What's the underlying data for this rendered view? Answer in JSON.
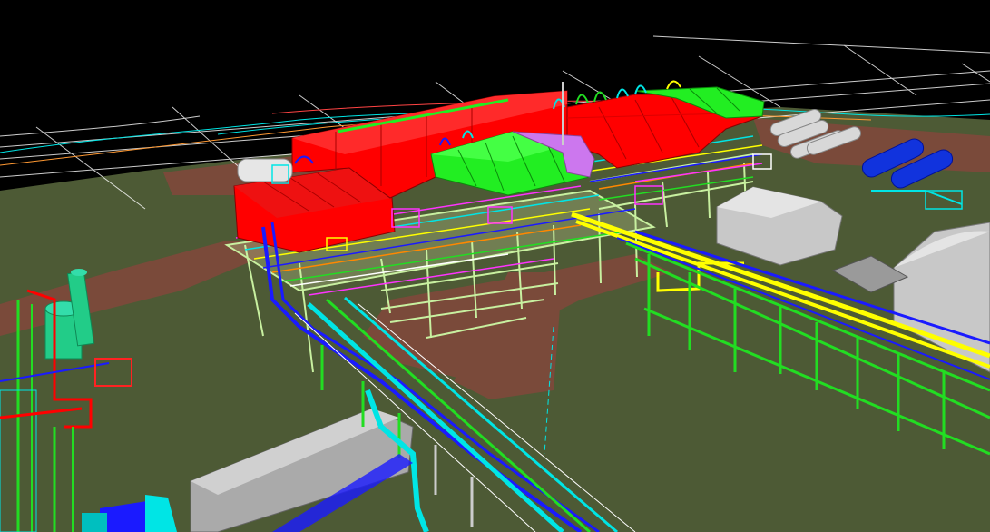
{
  "viewport": {
    "background": "#000000",
    "ground_color": "#4d5a35",
    "ground_path_color": "#7a4a3a",
    "grid_color": "#ffffff",
    "shelter_color": "#ff0000",
    "cooler_color": "#22ee22",
    "accent_violet": "#cc77ee",
    "pipe_green": "#22dd22",
    "pipe_yellow": "#ffff00",
    "pipe_blue": "#1a1aff",
    "pipe_cyan": "#00e5e5",
    "steel_light": "#c8f0a0",
    "tank_green": "#22cc88",
    "vessel_grey": "#d8d8d8",
    "building_grey": "#c0c0c0",
    "blue_vessel": "#1133dd"
  }
}
